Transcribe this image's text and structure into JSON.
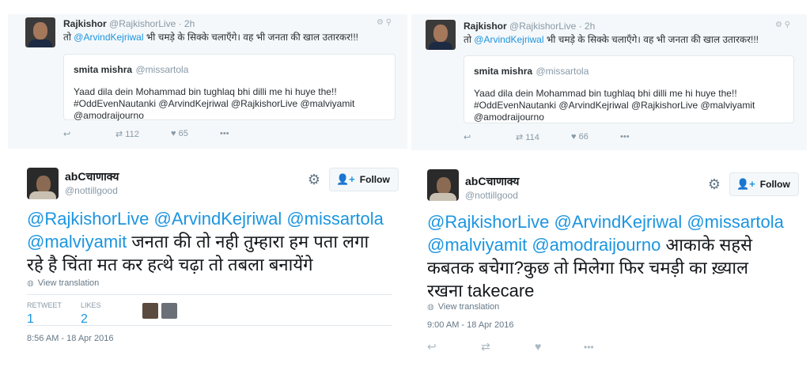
{
  "reply_left": {
    "author_name": "Rajkishor",
    "author_handle": "@RajkishorLive",
    "time": "· 2h",
    "mention": "@ArvindKejriwal",
    "text_before": "तो",
    "text_after": "भी चमड़े के सिक्के चलाएँगे। वह भी जनता की खाल उतारकर!!!",
    "quote": {
      "name": "smita mishra",
      "handle": "@missartola",
      "line1": "Yaad dila dein Mohammad bin tughlaq bhi dilli me hi huye the!!",
      "line2": "#OddEvenNautanki @ArvindKejriwal @RajkishorLive @malviyamit",
      "line3": "@amodraijourno"
    },
    "retweets": "112",
    "likes": "65"
  },
  "reply_right": {
    "author_name": "Rajkishor",
    "author_handle": "@RajkishorLive",
    "time": "· 2h",
    "mention": "@ArvindKejriwal",
    "text_before": "तो",
    "text_after": "भी चमड़े के सिक्के चलाएँगे। वह भी जनता की खाल उतारकर!!!",
    "quote": {
      "name": "smita mishra",
      "handle": "@missartola",
      "line1": "Yaad dila dein Mohammad bin tughlaq bhi dilli me hi huye the!!",
      "line2": "#OddEvenNautanki @ArvindKejriwal @RajkishorLive @malviyamit",
      "line3": "@amodraijourno"
    },
    "retweets": "114",
    "likes": "66"
  },
  "tweet_left": {
    "display_name": "abCचाणाक्य",
    "handle": "@nottillgood",
    "follow_label": "Follow",
    "line1_mentions": "@RajkishorLive @ArvindKejriwal @missartola",
    "line2_mention": "@malviyamit",
    "line2_text": " जनता की तो नही तुम्हारा हम पता लगा",
    "line3_text": "रहे है चिंता मत कर हत्थे चढ़ा तो तबला बनायेंगे",
    "view_translation": "View translation",
    "retweet_label": "RETWEET",
    "retweet_count": "1",
    "likes_label": "LIKES",
    "likes_count": "2",
    "timestamp": "8:56 AM - 18 Apr 2016"
  },
  "tweet_right": {
    "display_name": "abCचाणाक्य",
    "handle": "@nottillgood",
    "follow_label": "Follow",
    "line1_mentions": "@RajkishorLive @ArvindKejriwal @missartola",
    "line2_mentions": "@malviyamit @amodraijourno",
    "line2_text": " आकाके सहसे",
    "line3_text": "कबतक बचेगा?कुछ तो मिलेगा फिर चमड़ी का ख़्याल",
    "line4_text": "रखना takecare",
    "view_translation": "View translation",
    "timestamp": "9:00 AM - 18 Apr 2016"
  },
  "colors": {
    "link": "#1b95e0",
    "muted": "#8899a6",
    "card_bg": "#f5f8fa"
  },
  "icons": [
    "reply-icon",
    "retweet-icon",
    "heart-icon",
    "more-icon",
    "gear-icon",
    "follow-person-icon",
    "globe-icon",
    "pin-icon"
  ]
}
